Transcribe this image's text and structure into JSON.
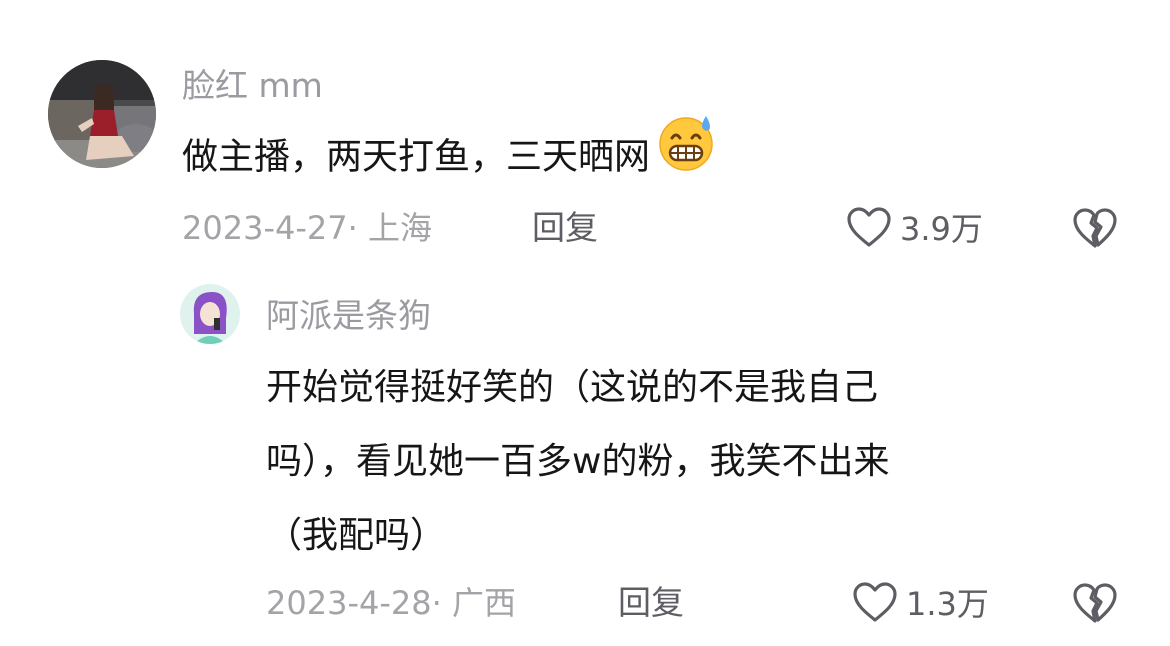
{
  "comments": [
    {
      "username": "脸红 mm",
      "text": "做主播，两天打鱼，三天晒网",
      "emoji": "grimacing-sweat-emoji",
      "meta": "2023-4-27· 上海",
      "reply_label": "回复",
      "likes": "3.9万"
    }
  ],
  "reply": {
    "username": "阿派是条狗",
    "lines": [
      "开始觉得挺好笑的（这说的不是我自己",
      "吗），看见她一百多w的粉，我笑不出来",
      "（我配吗）"
    ],
    "meta": "2023-4-28· 广西",
    "reply_label": "回复",
    "likes": "1.3万"
  },
  "icons": {
    "like": "heart-outline-icon",
    "dislike": "broken-heart-icon"
  },
  "colors": {
    "username": "#9a9aa0",
    "text": "#161616",
    "meta": "#a3a3a8",
    "action": "#5d5d63"
  }
}
